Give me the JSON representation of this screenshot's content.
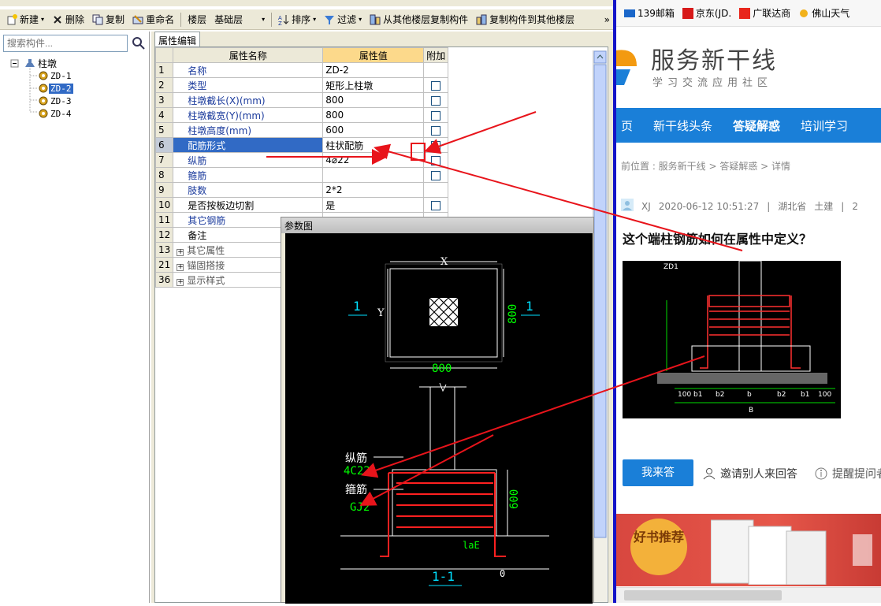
{
  "toolbar": {
    "items": [
      {
        "label": "新建",
        "caret": "▾"
      },
      {
        "label": "删除"
      },
      {
        "label": "复制"
      },
      {
        "label": "重命名"
      },
      {
        "label": "楼层"
      },
      {
        "label": "基础层",
        "caret": "▾"
      },
      {
        "label": "排序",
        "caret": "▾"
      },
      {
        "label": "过滤",
        "caret": "▾"
      },
      {
        "label": "从其他楼层复制构件"
      },
      {
        "label": "复制构件到其他楼层"
      }
    ],
    "more": "»"
  },
  "left": {
    "search_placeholder": "搜索构件...",
    "root": "柱墩",
    "items": [
      "ZD-1",
      "ZD-2",
      "ZD-3",
      "ZD-4"
    ],
    "selected": "ZD-2"
  },
  "form": {
    "tab": "属性编辑",
    "headers": {
      "name": "属性名称",
      "value": "属性值",
      "add": "附加"
    },
    "rows": [
      {
        "num": "1",
        "name": "名称",
        "value": "ZD-2",
        "check": false
      },
      {
        "num": "2",
        "name": "类型",
        "value": "矩形上柱墩",
        "check": true
      },
      {
        "num": "3",
        "name": "柱墩截长(X)(mm)",
        "value": "800",
        "check": true
      },
      {
        "num": "4",
        "name": "柱墩截宽(Y)(mm)",
        "value": "800",
        "check": true
      },
      {
        "num": "5",
        "name": "柱墩高度(mm)",
        "value": "600",
        "check": true
      },
      {
        "num": "6",
        "name": "配筋形式",
        "value": "柱状配筋",
        "check": true
      },
      {
        "num": "7",
        "name": "纵筋",
        "value": "4⌀22",
        "check": true
      },
      {
        "num": "8",
        "name": "箍筋",
        "value": "",
        "check": true
      },
      {
        "num": "9",
        "name": "肢数",
        "value": "2*2",
        "check": false
      },
      {
        "num": "10",
        "name": "是否按板边切割",
        "value": "是",
        "check": true
      },
      {
        "num": "11",
        "name": "其它钢筋",
        "value": "",
        "check": false
      },
      {
        "num": "12",
        "name": "备注",
        "value": "",
        "check": false
      },
      {
        "num": "13",
        "name": "其它属性",
        "group": true
      },
      {
        "num": "21",
        "name": "锚固搭接",
        "group": true
      },
      {
        "num": "36",
        "name": "显示样式",
        "group": true
      }
    ]
  },
  "diagram": {
    "title": "参数图",
    "x_label": "X",
    "y_label": "Y",
    "dim_800_h": "800",
    "dim_800_v": "800",
    "section_mark": "1",
    "zongjin_label": "纵筋",
    "zongjin_val": "4C22",
    "gujin_label": "箍筋",
    "gujin_val": "GJ2",
    "dim_600": "600",
    "lae": "laE",
    "zero": "0",
    "section_title": "1-1"
  },
  "browser": {
    "bookmarks": [
      "139邮箱",
      "京东(JD.",
      "广联达商",
      "佛山天气"
    ],
    "logo_title": "服务新干线",
    "logo_sub": "学习交流应用社区",
    "nav": [
      "页",
      "新干线头条",
      "答疑解惑",
      "培训学习"
    ],
    "nav_active": "答疑解惑",
    "breadcrumb": "前位置 : 服务新干线 > 答疑解惑 > 详情",
    "author": "XJ",
    "time": "2020-06-12 10:51:27",
    "region": "湖北省",
    "category": "土建",
    "extra": "2",
    "question": "这个端柱钢筋如何在属性中定义？",
    "answer_btn": "我来答",
    "invite": "邀请别人来回答",
    "remind": "提醒提问者",
    "banner_badge": "好书推荐"
  },
  "colors": {
    "nav_blue": "#1a7fd8",
    "selection": "#316ac5",
    "arrow": "#e8141b"
  }
}
